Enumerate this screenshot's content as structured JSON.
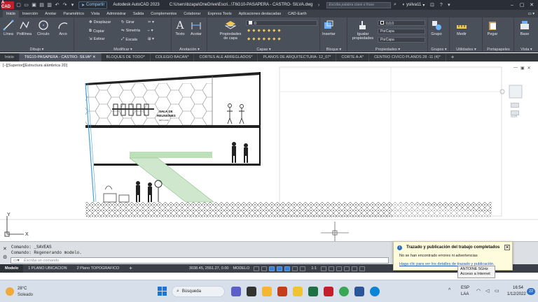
{
  "titlebar": {
    "logo": "A CAD",
    "share_label": "Compartir",
    "app_title": "Autodesk AutoCAD 2023",
    "file_path": "C:\\Users\\bzapa\\OneDrive\\Escri...\\T6G10-PASAPERA - CASTRO- SILVA.dwg",
    "search_placeholder": "Escriba palabra clave o frase",
    "username": "ysilva11"
  },
  "menu_tabs": [
    "Inicio",
    "Inserción",
    "Anotar",
    "Paramétrico",
    "Vista",
    "Administrar",
    "Salida",
    "Complementos",
    "Colaborar",
    "Express Tools",
    "Aplicaciones destacadas",
    "CAD-Earth"
  ],
  "ribbon": {
    "dibujo": {
      "label": "Dibujo ▾",
      "linea": "Línea",
      "polilinea": "Polilínea",
      "circulo": "Círculo",
      "arco": "Arco"
    },
    "modificar": {
      "label": "Modificar ▾",
      "desplazar": "Desplazar",
      "copiar": "Copiar",
      "estirar": "Estirar",
      "girar": "Girar",
      "simetria": "Simetría",
      "escala": "Escala"
    },
    "anotacion": {
      "label": "Anotación ▾",
      "texto": "Texto",
      "acotar": "Acotar"
    },
    "capas": {
      "label": "Capas ▾",
      "propiedades": "Propiedades de capa",
      "layer_value": "0"
    },
    "bloque": {
      "label": "Bloque ▾",
      "insertar": "Insertar"
    },
    "propiedades": {
      "label": "Propiedades ▾",
      "igualar": "Igualar propiedades",
      "color_value": "0,0,0",
      "linetype": "PorCapa",
      "lineweight": "PorCapa"
    },
    "grupos": {
      "label": "Grupos ▾",
      "grupo": "Grupo"
    },
    "utilidades": {
      "label": "Utilidades ▾",
      "medir": "Medir"
    },
    "portapapeles": {
      "label": "Portapapeles",
      "pegar": "Pegar"
    },
    "vista": {
      "label": "Vista ▾",
      "base": "Base"
    }
  },
  "file_tabs": [
    {
      "label": "Inicio",
      "active": false
    },
    {
      "label": "T6G10-PASAPERA - CASTRO- SILVA*",
      "active": true
    },
    {
      "label": "BLOQUES DE TODO*",
      "active": false
    },
    {
      "label": "COLEGIO BACAN*",
      "active": false
    },
    {
      "label": "CORTES ALE ARREGLADOS*",
      "active": false
    },
    {
      "label": "PLANOS DE ARQUITECTURA- 12_07*",
      "active": false
    },
    {
      "label": "CORTE A-A*",
      "active": false
    },
    {
      "label": "CENTRO CIVICO PLANOS 28 -11 (4)*",
      "active": false
    }
  ],
  "drawing": {
    "viewport_label": "[−][Superior][Estructura alámbrica 2D]",
    "room_label_1": "SALA DE",
    "room_label_2": "REUNIONES",
    "level_text": "NPT+0.00",
    "nav_label": "SUR",
    "ucs_y": "Y",
    "ucs_x": "X"
  },
  "command": {
    "line1": "Comando: _SAVEAS",
    "line2": "Comando: Regenerando modelo.",
    "placeholder": "Escriba un comando"
  },
  "layout_tabs": [
    "Modelo",
    "1 PLANO UBICACION",
    "2 Plano TOPOGRAFICO"
  ],
  "status": {
    "coords": "3038.45, 2551.27, 0.00",
    "mode": "MODELO",
    "scale": "1:1"
  },
  "notification": {
    "title": "Trazado y publicación del trabajo completados",
    "message": "No se han encontrado errores ni advertencias",
    "link": "Haga clic para ver los detalles de trazado y publicación."
  },
  "tooltip": {
    "line1": "ANTOINE 5GHz",
    "line2": "Acceso a Internet"
  },
  "taskbar": {
    "temperature": "28°C",
    "weather": "Soleado",
    "search": "Búsqueda",
    "lang1": "ESP",
    "lang2": "LAA",
    "time": "16:54",
    "date": "1/12/2022",
    "notif_count": "22"
  },
  "colors": {
    "accent": "#3a7ed5",
    "autocad_red": "#c41e2a",
    "green_hatch": "#9fd49a"
  }
}
